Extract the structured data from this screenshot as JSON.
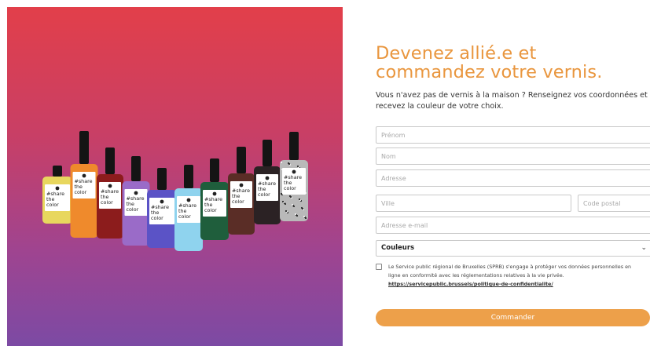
{
  "hero": {
    "bottles": [
      {
        "color": "#e8d75e",
        "label": [
          "#share",
          "the",
          "color"
        ]
      },
      {
        "color": "#ef8a2c",
        "label": [
          "#share",
          "the",
          "color"
        ]
      },
      {
        "color": "#8c1c1c",
        "label": [
          "#share",
          "the",
          "color"
        ]
      },
      {
        "color": "#9a6bc8",
        "label": [
          "#share",
          "the",
          "color"
        ]
      },
      {
        "color": "#5b53c6",
        "label": [
          "#share",
          "the",
          "color"
        ]
      },
      {
        "color": "#8fd3ee",
        "label": [
          "#share",
          "the",
          "color"
        ]
      },
      {
        "color": "#1f5e3c",
        "label": [
          "#share",
          "the",
          "color"
        ]
      },
      {
        "color": "#5a2d26",
        "label": [
          "#share",
          "the",
          "color"
        ]
      },
      {
        "color": "#2b2224",
        "label": [
          "#share",
          "the",
          "color"
        ]
      },
      {
        "color": "#b9b9b9",
        "label": [
          "#share",
          "the",
          "color"
        ]
      }
    ]
  },
  "form": {
    "title": "Devenez allié.e et commandez votre vernis.",
    "intro": "Vous n'avez pas de vernis à la maison ? Renseignez vos coordonnées et recevez la couleur de votre choix.",
    "fields": {
      "firstname": "Prénom",
      "lastname": "Nom",
      "address": "Adresse",
      "city": "Ville",
      "postal": "Code postal",
      "email": "Adresse e-mail"
    },
    "color_select": "Couleurs",
    "consent": {
      "line1": "Le Service public régional de Bruxelles (SPRB) s'engage à protéger vos données personnelles en",
      "line2": "ligne en conformité avec les réglementations relatives à la vie privée.",
      "link": "https://servicepublic.brussels/politique-de-confidentialite/"
    },
    "submit": "Commander"
  },
  "colors": {
    "accent": "#e9963e",
    "button": "#eda04a",
    "hero_top": "#e23f4a",
    "hero_bottom": "#7c4aa4"
  }
}
